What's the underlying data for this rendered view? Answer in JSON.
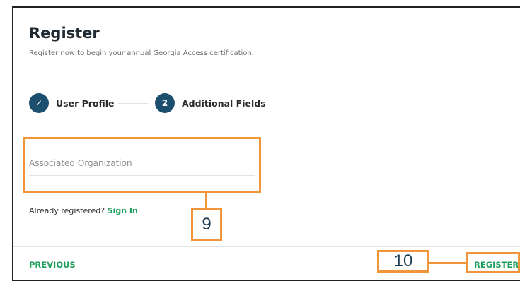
{
  "form": {
    "title": "Register",
    "subtitle": "Register now to begin your annual Georgia Access certification."
  },
  "steps": [
    {
      "label": "User Profile",
      "state": "complete",
      "icon": "check-icon",
      "marker": "✓"
    },
    {
      "label": "Additional Fields",
      "state": "current",
      "marker": "2"
    }
  ],
  "fields": {
    "associated_organization": {
      "placeholder": "Associated Organization",
      "value": ""
    }
  },
  "signin": {
    "prompt": "Already registered?",
    "link_label": "Sign In"
  },
  "footer": {
    "previous_label": "PREVIOUS",
    "register_label": "REGISTER"
  },
  "annotations": [
    {
      "number": "9",
      "target": "associated-organization-field"
    },
    {
      "number": "10",
      "target": "register-button"
    }
  ],
  "colors": {
    "accent_green": "#1e9e5c",
    "step_navy": "#1c4f6e",
    "annotation_orange": "#f0953a"
  }
}
